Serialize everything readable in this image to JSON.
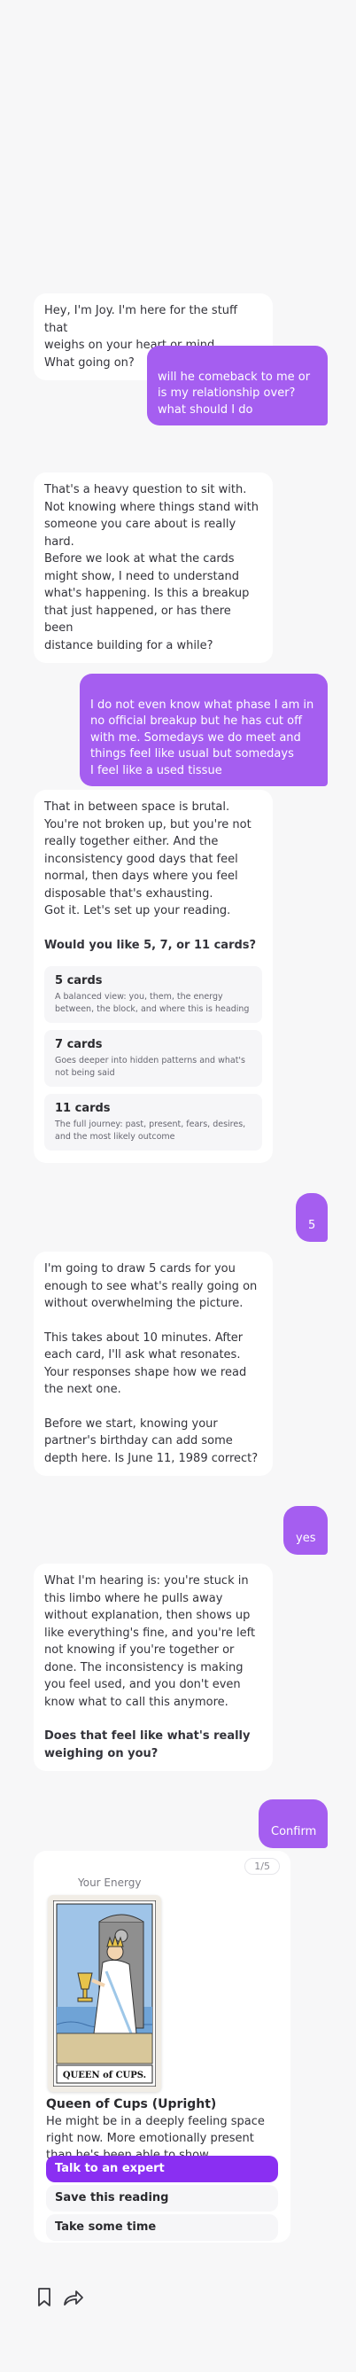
{
  "messages": {
    "m1": "Hey, I'm Joy. I'm here for the stuff that\nweighs on your heart or mind.\nWhat going on?",
    "u1": "will he comeback to me or\nis my relationship over?\nwhat should I do",
    "m2": "That's a heavy question to sit with.\nNot knowing where things stand with\nsomeone you care about is really\nhard.\nBefore we look at what the cards\nmight show, I need to understand\nwhat's happening. Is this a breakup\nthat just happened, or has there been\ndistance building for a while?",
    "u2": "I do not even know what phase I am in\nno official breakup but he has cut off\nwith me. Somedays we do meet and\nthings feel like usual but somedays\nI feel like a used tissue",
    "m3_text": "That in between space is brutal.\nYou're not broken up, but you're not\nreally together either. And the\ninconsistency  good days that feel\nnormal, then days where you feel\ndisposable that's exhausting.\nGot it. Let's set up your reading.",
    "m3_question": "Would you like 5, 7, or 11 cards?",
    "options": [
      {
        "title": "5 cards",
        "desc": "A balanced view: you, them, the energy between, the block, and where this is heading"
      },
      {
        "title": "7 cards",
        "desc": "Goes deeper into hidden patterns and what's not being said"
      },
      {
        "title": "11 cards",
        "desc": "The full journey: past, present, fears, desires, and the most likely outcome"
      }
    ],
    "u3": "5",
    "m4_p1": "I'm going to draw 5 cards for you\nenough to see what's really going on\nwithout overwhelming the picture.",
    "m4_p2": "This takes about 10 minutes. After\neach card, I'll ask what resonates.\nYour responses shape how we read\nthe next one.",
    "m4_p3": "Before we start, knowing your\npartner's birthday can add some\ndepth here. Is June 11, 1989 correct?",
    "u4": "yes",
    "m5_p1": "What I'm hearing is: you're stuck in\nthis limbo where he pulls away\nwithout explanation, then shows up\nlike everything's fine, and you're left\nnot knowing if you're together or\ndone. The inconsistency is making\nyou feel used, and you don't even\nknow what to call this anymore.",
    "m5_question": "Does that feel like what's really\nweighing on you?",
    "u5": "Confirm"
  },
  "reading": {
    "counter": "1/5",
    "position_label": "Your Energy",
    "card_name_on_card": "QUEEN of CUPS.",
    "card_title": "Queen of Cups (Upright)",
    "card_desc": "He might be in a deeply feeling space right now. More emotionally present than he's been able to show.",
    "buttons": {
      "talk": "Talk to an expert",
      "save": "Save this reading",
      "time": "Take some time"
    }
  },
  "actions": {
    "bookmark_icon": "bookmark-icon",
    "share_icon": "share-arrow-icon"
  },
  "colors": {
    "accent": "#8a2ff2",
    "user_bubble": "#a55ef0",
    "background": "#f7f7f8"
  }
}
